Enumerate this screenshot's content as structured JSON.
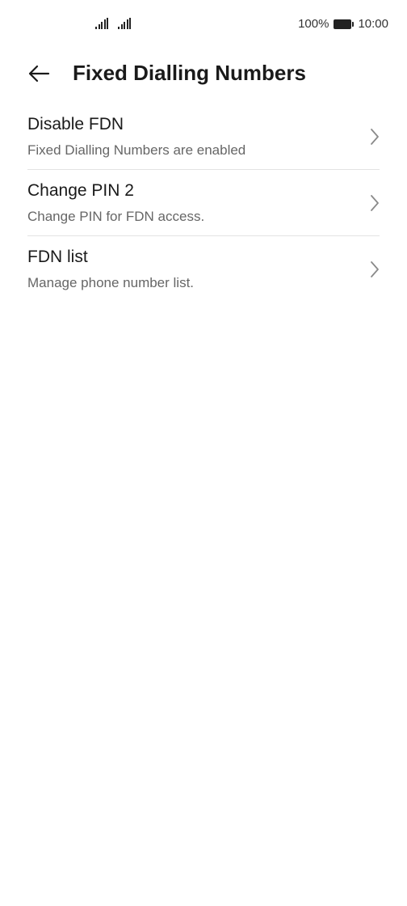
{
  "status_bar": {
    "battery_percent": "100%",
    "time": "10:00",
    "signal_icons": [
      "signal-icon",
      "signal-icon"
    ]
  },
  "header": {
    "back_icon": "arrow-left-icon",
    "title": "Fixed Dialling Numbers"
  },
  "items": [
    {
      "title": "Disable FDN",
      "subtitle": "Fixed Dialling Numbers are enabled",
      "icon": "chevron-right-icon"
    },
    {
      "title": "Change PIN 2",
      "subtitle": "Change PIN for FDN access.",
      "icon": "chevron-right-icon"
    },
    {
      "title": "FDN list",
      "subtitle": "Manage phone number list.",
      "icon": "chevron-right-icon"
    }
  ],
  "colors": {
    "background": "#ffffff",
    "title_text": "#1a1a1a",
    "subtitle_text": "#666666",
    "divider": "#e3e3e3",
    "chevron": "#8a8a8a"
  }
}
